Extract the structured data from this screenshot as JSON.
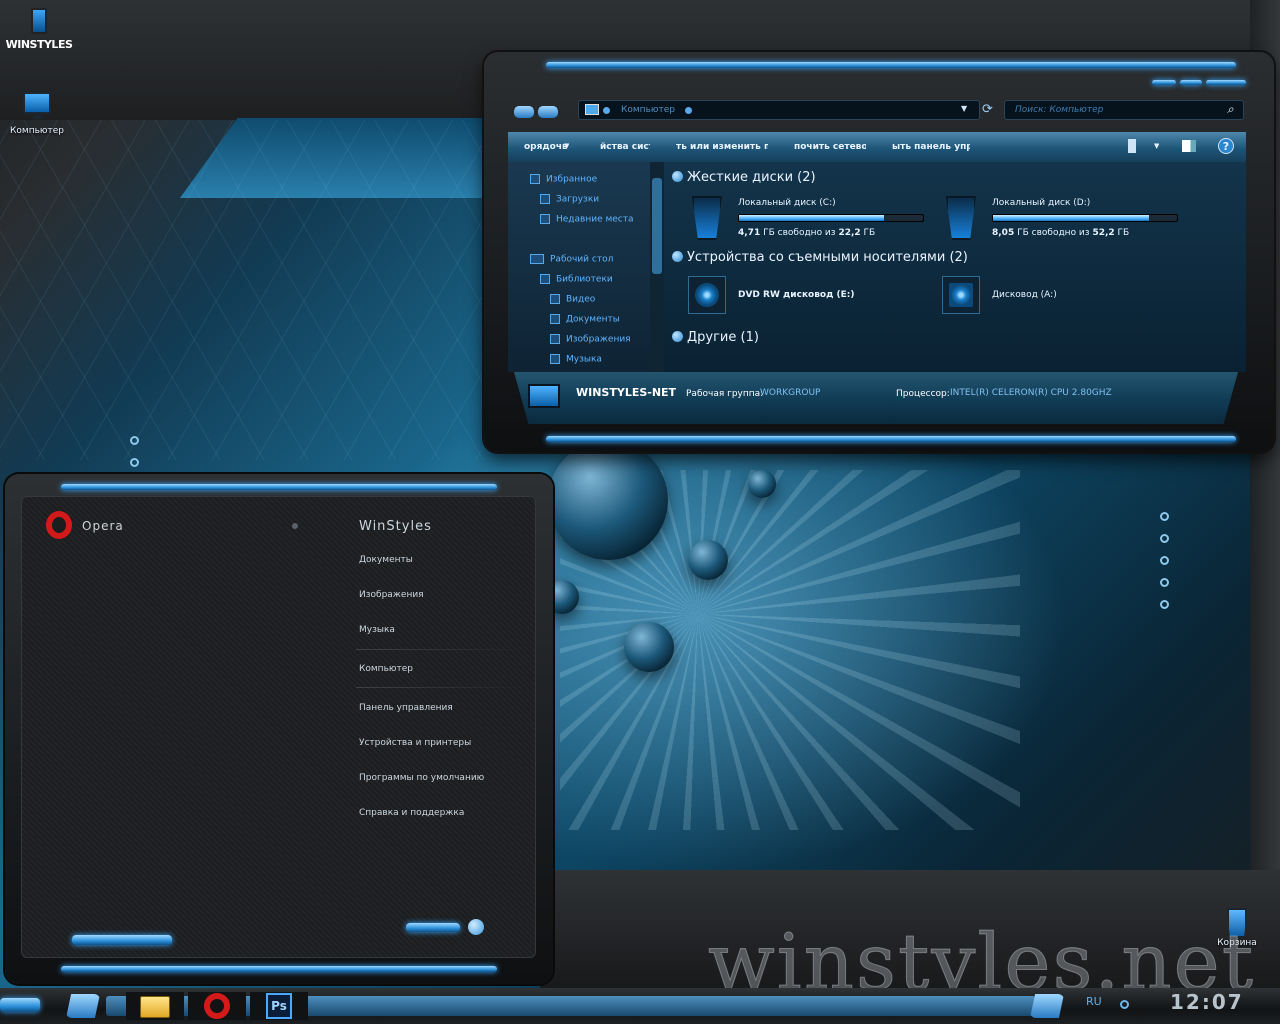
{
  "desktop": {
    "logo_text": "WINSTYLES",
    "icons": [
      {
        "label": "Компьютер",
        "icon": "computer-icon"
      },
      {
        "label": "Корзина",
        "icon": "recycle-bin-icon"
      }
    ],
    "watermark": "winstyles.net"
  },
  "explorer": {
    "address": {
      "text": "Компьютер",
      "icon": "computer-icon"
    },
    "search_placeholder": "Поиск: Компьютер",
    "toolbar": {
      "organize": "орядочь",
      "system_props": "йства систе",
      "uninstall": "ть или изменить прог",
      "map_network": "почить сетевой",
      "control_panel": "ыть панель управ"
    },
    "nav": {
      "favorites": "Избранное",
      "downloads": "Загрузки",
      "recent": "Недавние места",
      "desktop": "Рабочий стол",
      "libraries": "Библиотеки",
      "video": "Видео",
      "documents": "Документы",
      "pictures": "Изображения",
      "music": "Музыка"
    },
    "groups": {
      "hdd": "Жесткие диски (2)",
      "removable": "Устройства со съемными носителями (2)",
      "other": "Другие (1)"
    },
    "drives": [
      {
        "name": "Локальный диск (C:)",
        "free": "4,71",
        "total": "22,2",
        "unit": "ГБ",
        "free_label": "свободно из",
        "used_fraction": 0.79
      },
      {
        "name": "Локальный диск (D:)",
        "free": "8,05",
        "total": "52,2",
        "unit": "ГБ",
        "free_label": "свободно из",
        "used_fraction": 0.85
      }
    ],
    "removable": [
      {
        "name": "DVD RW дисковод (E:)"
      },
      {
        "name": "Дисковод (A:)"
      }
    ],
    "details": {
      "computer_name": "WINSTYLES-NET",
      "workgroup_label": "Рабочая группа:",
      "workgroup": "WORKGROUP",
      "cpu_label": "Процессор:",
      "cpu": "INTEL(R) CELERON(R) CPU 2.80GHZ"
    }
  },
  "start_menu": {
    "pinned_app": "Opera",
    "user": "WinStyles",
    "items": [
      "Документы",
      "Изображения",
      "Музыка",
      "Компьютер",
      "Панель управления",
      "Устройства и принтеры",
      "Программы по умолчанию",
      "Справка и поддержка"
    ]
  },
  "taskbar": {
    "apps": [
      {
        "name": "explorer",
        "icon": "folder-icon"
      },
      {
        "name": "opera",
        "icon": "opera-icon"
      },
      {
        "name": "photoshop",
        "icon": "photoshop-icon",
        "label": "Ps"
      }
    ],
    "lang": "RU",
    "time": "12:07"
  }
}
